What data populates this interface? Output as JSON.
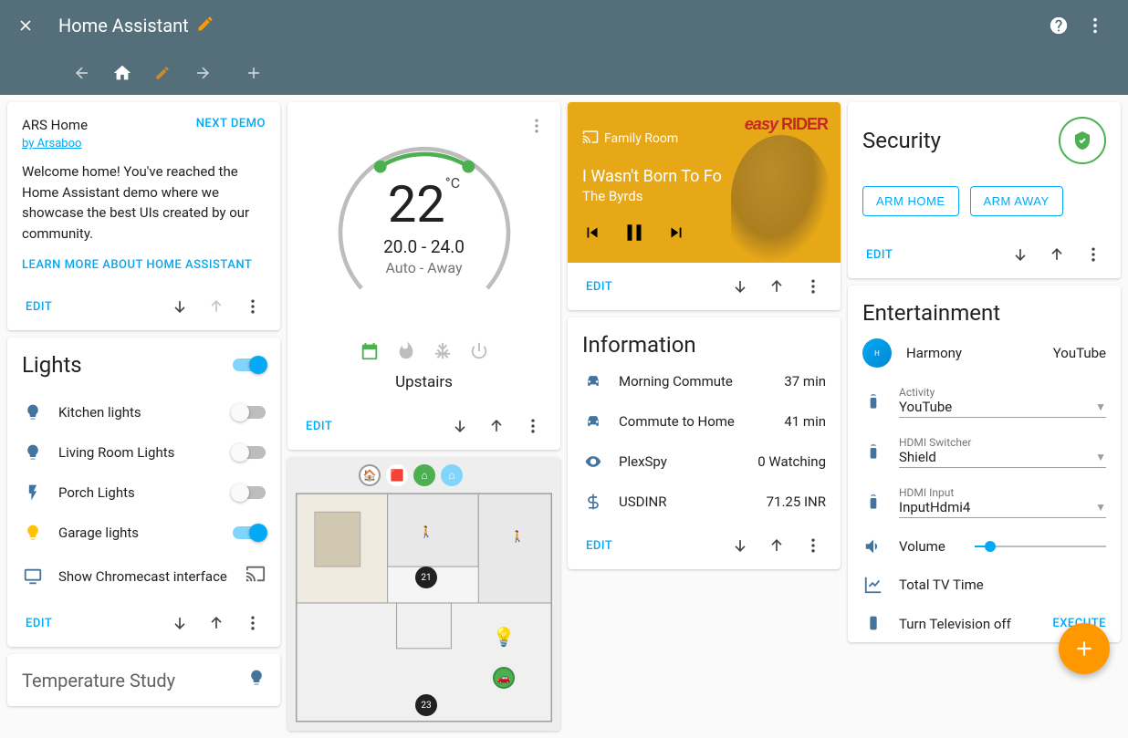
{
  "header": {
    "title": "Home Assistant"
  },
  "welcome": {
    "title": "ARS Home",
    "by_prefix": "by ",
    "author": "Arsaboo",
    "next_demo": "NEXT DEMO",
    "body": "Welcome home! You've reached the Home Assistant demo where we showcase the best UIs created by our community.",
    "learn_more": "LEARN MORE ABOUT HOME ASSISTANT",
    "edit": "EDIT"
  },
  "lights": {
    "title": "Lights",
    "master_on": true,
    "items": [
      {
        "icon": "bulb",
        "label": "Kitchen lights",
        "on": false
      },
      {
        "icon": "bulb",
        "label": "Living Room Lights",
        "on": false
      },
      {
        "icon": "flash",
        "label": "Porch Lights",
        "on": false
      },
      {
        "icon": "bulb-on",
        "label": "Garage lights",
        "on": true
      }
    ],
    "chromecast_label": "Show Chromecast interface",
    "edit": "EDIT"
  },
  "temp_study": {
    "title": "Temperature Study"
  },
  "thermostat": {
    "temp": "22",
    "unit": "°C",
    "range": "20.0 - 24.0",
    "mode": "Auto - Away",
    "name": "Upstairs",
    "edit": "EDIT"
  },
  "media": {
    "room": "Family Room",
    "title": "I Wasn't Born To Fo",
    "artist": "The Byrds",
    "poster_title_a": "easy",
    "poster_title_b": "RIDER",
    "edit": "EDIT"
  },
  "information": {
    "title": "Information",
    "rows": [
      {
        "icon": "car",
        "label": "Morning Commute",
        "value": "37 min"
      },
      {
        "icon": "car",
        "label": "Commute to Home",
        "value": "41 min"
      },
      {
        "icon": "eye",
        "label": "PlexSpy",
        "value": "0 Watching"
      },
      {
        "icon": "dollar",
        "label": "USDINR",
        "value": "71.25 INR"
      }
    ],
    "edit": "EDIT"
  },
  "security": {
    "title": "Security",
    "arm_home": "ARM HOME",
    "arm_away": "ARM AWAY",
    "edit": "EDIT"
  },
  "entertainment": {
    "title": "Entertainment",
    "harmony_label": "Harmony",
    "harmony_value": "YouTube",
    "fields": [
      {
        "label": "Activity",
        "value": "YouTube"
      },
      {
        "label": "HDMI Switcher",
        "value": "Shield"
      },
      {
        "label": "HDMI Input",
        "value": "InputHdmi4"
      }
    ],
    "volume_label": "Volume",
    "volume_pct": 12,
    "tv_time_label": "Total TV Time",
    "tv_off_label": "Turn Television off",
    "execute": "EXECUTE"
  }
}
